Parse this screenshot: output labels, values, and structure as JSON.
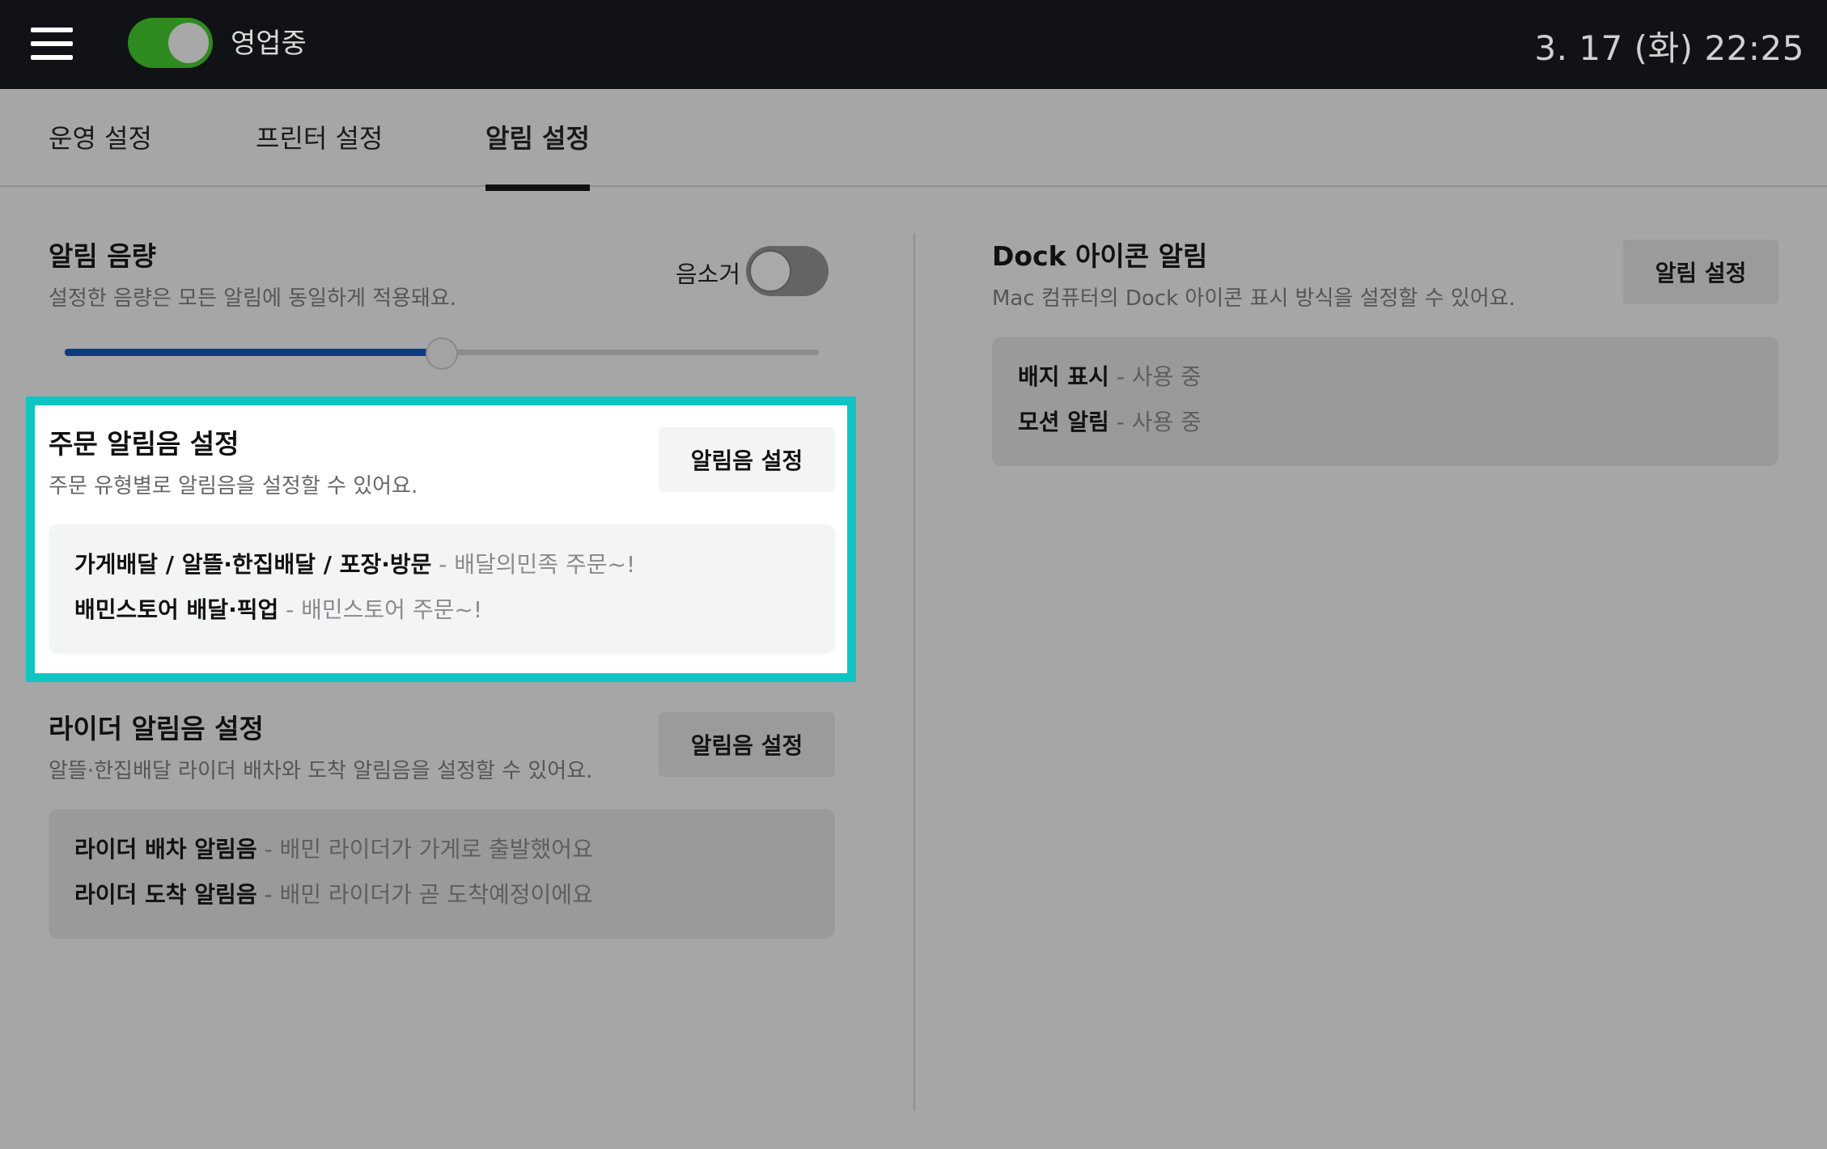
{
  "topbar": {
    "menu_icon": "hamburger-menu-icon",
    "store_toggle": {
      "label": "영업중",
      "on": true
    },
    "datetime": "3. 17 (화) 22:25"
  },
  "tabs": [
    {
      "label": "운영 설정",
      "active": false
    },
    {
      "label": "프린터 설정",
      "active": false
    },
    {
      "label": "알림 설정",
      "active": true
    }
  ],
  "volume": {
    "title": "알림 음량",
    "description": "설정한 음량은 모든 알림에 동일하게 적용돼요.",
    "mute_label": "음소거",
    "muted": false,
    "level": 0.5
  },
  "order_sound": {
    "title": "주문 알림음 설정",
    "description": "주문 유형별로 알림음을 설정할 수 있어요.",
    "button": "알림음 설정",
    "rows": [
      {
        "name": "가게배달 / 알뜰·한집배달 / 포장·방문",
        "sep": " - ",
        "value": "배달의민족 주문~!"
      },
      {
        "name": "배민스토어 배달·픽업",
        "sep": " - ",
        "value": "배민스토어 주문~!"
      }
    ]
  },
  "rider_sound": {
    "title": "라이더 알림음 설정",
    "description": "알뜰·한집배달 라이더 배차와 도착 알림음을 설정할 수 있어요.",
    "button": "알림음 설정",
    "rows": [
      {
        "name": "라이더 배차 알림음",
        "sep": " - ",
        "value": "배민 라이더가 가게로 출발했어요"
      },
      {
        "name": "라이더 도착 알림음",
        "sep": " - ",
        "value": "배민 라이더가 곧 도착예정이에요"
      }
    ]
  },
  "dock": {
    "title": "Dock 아이콘 알림",
    "description": "Mac 컴퓨터의 Dock 아이콘 표시 방식을 설정할 수 있어요.",
    "button": "알림 설정",
    "rows": [
      {
        "name": "배지 표시",
        "sep": " - ",
        "value": "사용 중"
      },
      {
        "name": "모션 알림",
        "sep": " - ",
        "value": "사용 중"
      }
    ]
  },
  "colors": {
    "highlight_border": "#0fc4c2",
    "toggle_on": "#2e8b1f",
    "slider_fill": "#0e3a80"
  }
}
